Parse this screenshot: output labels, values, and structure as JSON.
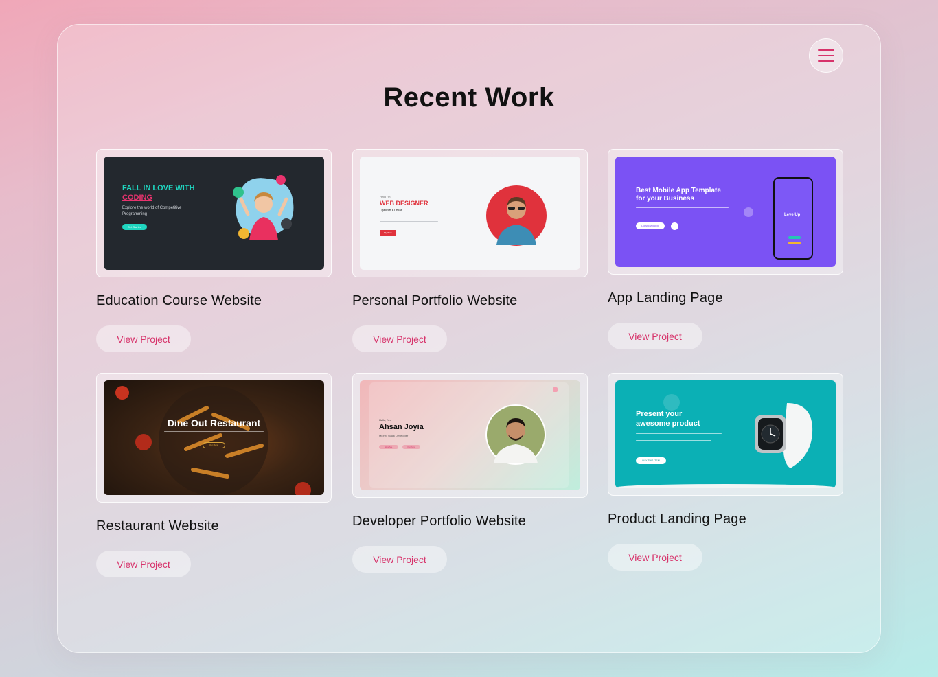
{
  "page": {
    "title": "Recent Work",
    "menu_icon": "hamburger-icon",
    "accent_color": "#d7336b"
  },
  "projects": [
    {
      "title": "Education Course Website",
      "button": "View Project",
      "preview": {
        "heading_line1": "FALL IN LOVE WITH",
        "heading_line2": "CODING",
        "text_line1": "Explore the world of Competitive",
        "text_line2": "Programming",
        "button": "Get Started"
      }
    },
    {
      "title": "Personal Portfolio Website",
      "button": "View Project",
      "preview": {
        "greeting": "Hello I'm",
        "heading": "WEB DESIGNER",
        "name": "Ujwesh Kumar",
        "button": "My Work"
      }
    },
    {
      "title": "App Landing Page",
      "button": "View Project",
      "preview": {
        "heading_line1": "Best Mobile App Template",
        "heading_line2": "for your Business",
        "button": "Download App",
        "phone_logo": "LevelUp"
      }
    },
    {
      "title": "Restaurant Website",
      "button": "View Project",
      "preview": {
        "heading": "Dine Out Restaurant",
        "button": "Our Menu"
      }
    },
    {
      "title": "Developer Portfolio Website",
      "button": "View Project",
      "preview": {
        "greeting": "Hello, I'm",
        "name": "Ahsan Joyia",
        "role": "MERN Stack Developer",
        "button1": "Hire Me",
        "button2": "Portfolio"
      }
    },
    {
      "title": "Product Landing Page",
      "button": "View Project",
      "preview": {
        "heading_line1": "Present your",
        "heading_line2": "awesome product",
        "button": "BUY THIS ITEM"
      }
    }
  ]
}
